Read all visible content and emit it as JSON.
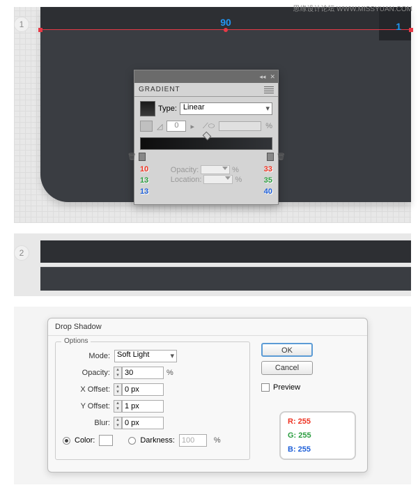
{
  "watermark": "思缘设计论坛  WWW.MISSYUAN.COM",
  "step1": "1",
  "step2": "2",
  "measurement": "90",
  "side_measurement": "1",
  "gradient_panel": {
    "title": "GRADIENT",
    "type_label": "Type:",
    "type_value": "Linear",
    "angle_value": "0",
    "opacity_label": "Opacity:",
    "location_label": "Location:",
    "left_rgb": {
      "r": "10",
      "g": "13",
      "b": "13"
    },
    "right_rgb": {
      "r": "33",
      "g": "35",
      "b": "40"
    },
    "percent": "%"
  },
  "drop_shadow": {
    "title": "Drop Shadow",
    "options_label": "Options",
    "mode_label": "Mode:",
    "mode_value": "Soft Light",
    "opacity_label": "Opacity:",
    "opacity_value": "30",
    "xoffset_label": "X Offset:",
    "xoffset_value": "0 px",
    "yoffset_label": "Y Offset:",
    "yoffset_value": "1 px",
    "blur_label": "Blur:",
    "blur_value": "0 px",
    "color_label": "Color:",
    "darkness_label": "Darkness:",
    "darkness_value": "100",
    "percent": "%",
    "ok": "OK",
    "cancel": "Cancel",
    "preview": "Preview",
    "rgb": {
      "r": "R: 255",
      "g": "G: 255",
      "b": "B: 255"
    }
  }
}
